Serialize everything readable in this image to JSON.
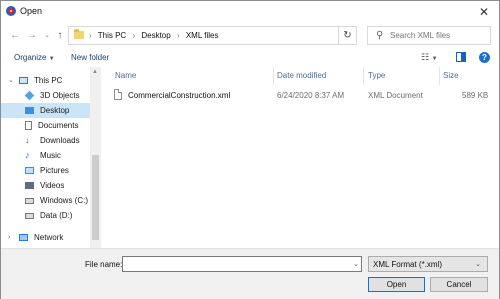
{
  "window": {
    "title": "Open"
  },
  "address": {
    "crumbs": [
      "This PC",
      "Desktop",
      "XML files"
    ]
  },
  "search": {
    "placeholder": "Search XML files"
  },
  "toolbar": {
    "organize_label": "Organize",
    "new_folder_label": "New folder"
  },
  "sidebar": {
    "items": [
      {
        "label": "This PC",
        "icon": "computer-icon"
      },
      {
        "label": "3D Objects",
        "icon": "cube-icon"
      },
      {
        "label": "Desktop",
        "icon": "desktop-icon",
        "selected": true
      },
      {
        "label": "Documents",
        "icon": "documents-icon"
      },
      {
        "label": "Downloads",
        "icon": "download-arrow-icon"
      },
      {
        "label": "Music",
        "icon": "music-note-icon"
      },
      {
        "label": "Pictures",
        "icon": "pictures-icon"
      },
      {
        "label": "Videos",
        "icon": "video-icon"
      },
      {
        "label": "Windows (C:)",
        "icon": "drive-icon"
      },
      {
        "label": "Data (D:)",
        "icon": "drive-icon"
      },
      {
        "label": "Network",
        "icon": "network-icon"
      }
    ]
  },
  "filelist": {
    "columns": {
      "name": "Name",
      "date": "Date modified",
      "type": "Type",
      "size": "Size"
    },
    "rows": [
      {
        "name": "CommercialConstruction.xml",
        "date": "6/24/2020 8:37 AM",
        "type": "XML Document",
        "size": "589 KB"
      }
    ]
  },
  "bottom": {
    "filename_label": "File name:",
    "filename_value": "",
    "filetype_value": "XML Format (*.xml)",
    "open_label": "Open",
    "cancel_label": "Cancel"
  },
  "colors": {
    "selection": "#cce4f7",
    "accent": "#0078d7",
    "link": "#1a3e73"
  }
}
